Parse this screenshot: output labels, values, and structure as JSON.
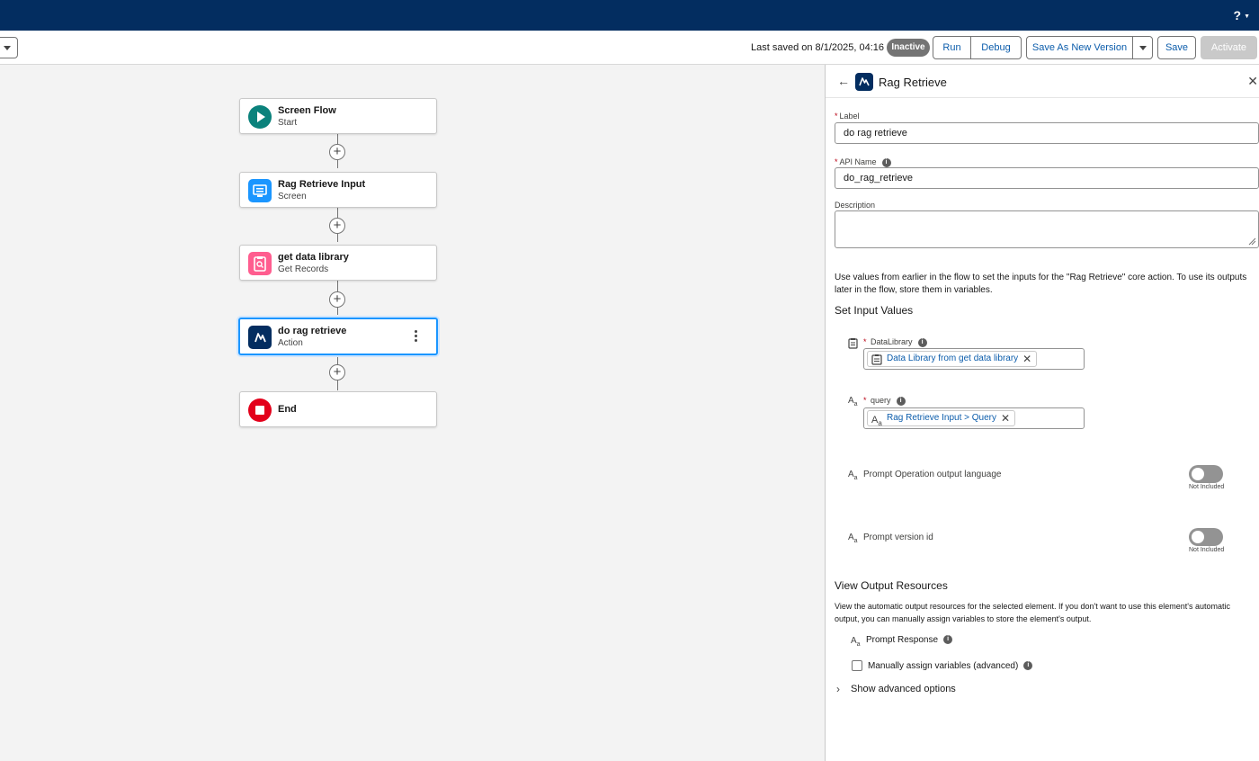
{
  "topbar": {
    "help_label": "?"
  },
  "toolbar": {
    "last_saved": "Last saved on 8/1/2025, 04:16 PM",
    "status_badge": "Inactive",
    "run_label": "Run",
    "debug_label": "Debug",
    "save_as_new_version_label": "Save As New Version",
    "save_label": "Save",
    "activate_label": "Activate"
  },
  "flow": {
    "nodes": [
      {
        "title": "Screen Flow",
        "subtitle": "Start",
        "icon": "play-icon",
        "color": "#0b827c"
      },
      {
        "title": "Rag Retrieve Input",
        "subtitle": "Screen",
        "icon": "screen-icon",
        "color": "#1b96ff"
      },
      {
        "title": "get data library",
        "subtitle": "Get Records",
        "icon": "get-records-icon",
        "color": "#ff5d8f"
      },
      {
        "title": "do rag retrieve",
        "subtitle": "Action",
        "icon": "action-icon",
        "color": "#032d60"
      },
      {
        "title": "End",
        "subtitle": "",
        "icon": "stop-icon",
        "color": "#e3001b"
      }
    ],
    "add_element_symbol": "+"
  },
  "panel": {
    "title": "Rag Retrieve",
    "label_field": {
      "label": "Label",
      "value": "do rag retrieve"
    },
    "api_name_field": {
      "label": "API Name",
      "value": "do_rag_retrieve"
    },
    "description_field": {
      "label": "Description",
      "value": ""
    },
    "intro_text": "Use values from earlier in the flow to set the inputs for the \"Rag Retrieve\" core action. To use its outputs later in the flow, store them in variables.",
    "set_input_values_heading": "Set Input Values",
    "inputs": [
      {
        "label": "DataLibrary",
        "value": "Data Library from get data library",
        "icon": "clipboard-icon"
      },
      {
        "label": "query",
        "value": "Rag Retrieve Input > Query",
        "icon": "text-icon"
      }
    ],
    "optional_inputs": [
      {
        "label": "Prompt Operation output language",
        "toggle_status": "Not Included"
      },
      {
        "label": "Prompt version id",
        "toggle_status": "Not Included"
      }
    ],
    "output_heading": "View Output Resources",
    "output_text": "View the automatic output resources for the selected element. If you don't want to use this element's automatic output, you can manually assign variables to store the element's output.",
    "output_resource": "Prompt Response",
    "manual_assign_label": "Manually assign variables (advanced)",
    "advanced_options_label": "Show advanced options"
  }
}
